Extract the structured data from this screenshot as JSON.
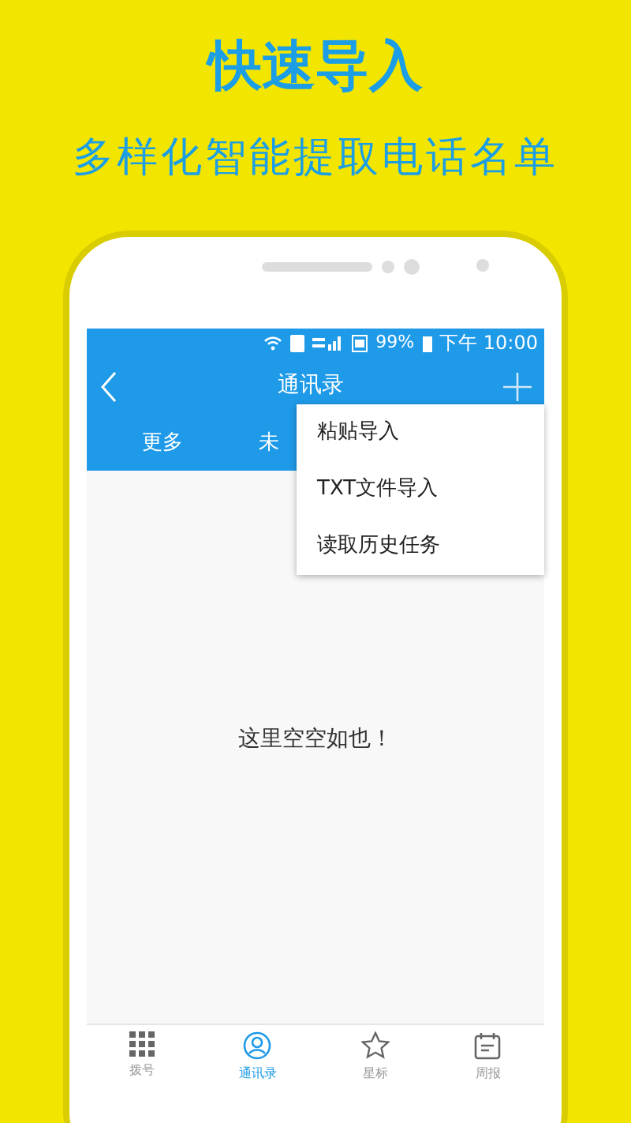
{
  "headline": "快速导入",
  "subtitle": "多样化智能提取电话名单",
  "status_bar": {
    "battery": "99%",
    "time": "下午 10:00"
  },
  "app_bar": {
    "title": "通讯录"
  },
  "tabs": [
    {
      "label": "更多"
    },
    {
      "label": "未"
    }
  ],
  "menu": [
    "粘贴导入",
    "TXT文件导入",
    "读取历史任务"
  ],
  "empty_message": "这里空空如也！",
  "bottom_nav": [
    {
      "label": "拨号",
      "kind": "dialpad",
      "selected": false
    },
    {
      "label": "通讯录",
      "kind": "contact",
      "selected": true
    },
    {
      "label": "星标",
      "kind": "star",
      "selected": false
    },
    {
      "label": "周报",
      "kind": "calendar",
      "selected": false
    }
  ]
}
